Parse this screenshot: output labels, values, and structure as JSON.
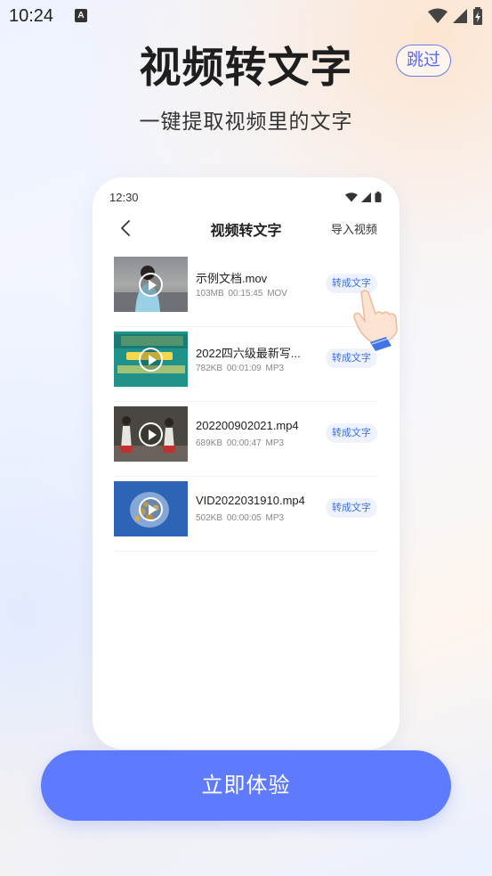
{
  "status_bar": {
    "time": "10:24",
    "notification_letter": "A"
  },
  "header": {
    "title": "视频转文字",
    "skip_label": "跳过",
    "subtitle": "一键提取视频里的文字"
  },
  "phone": {
    "time": "12:30",
    "title": "视频转文字",
    "import_label": "导入视频",
    "videos": [
      {
        "name": "示例文档.mov",
        "size": "103MB",
        "duration": "00:15:45",
        "format": "MOV",
        "action": "转成文字"
      },
      {
        "name": "2022四六级最新写...",
        "size": "782KB",
        "duration": "00:01:09",
        "format": "MP3",
        "action": "转成文字"
      },
      {
        "name": "202200902021.mp4",
        "size": "689KB",
        "duration": "00:00:47",
        "format": "MP3",
        "action": "转成文字"
      },
      {
        "name": "VID2022031910.mp4",
        "size": "502KB",
        "duration": "00:00:05",
        "format": "MP3",
        "action": "转成文字"
      }
    ]
  },
  "cta": {
    "label": "立即体验"
  },
  "colors": {
    "accent": "#5e7bff",
    "button_text": "#3d6ee8",
    "button_bg": "#edf2fc"
  }
}
